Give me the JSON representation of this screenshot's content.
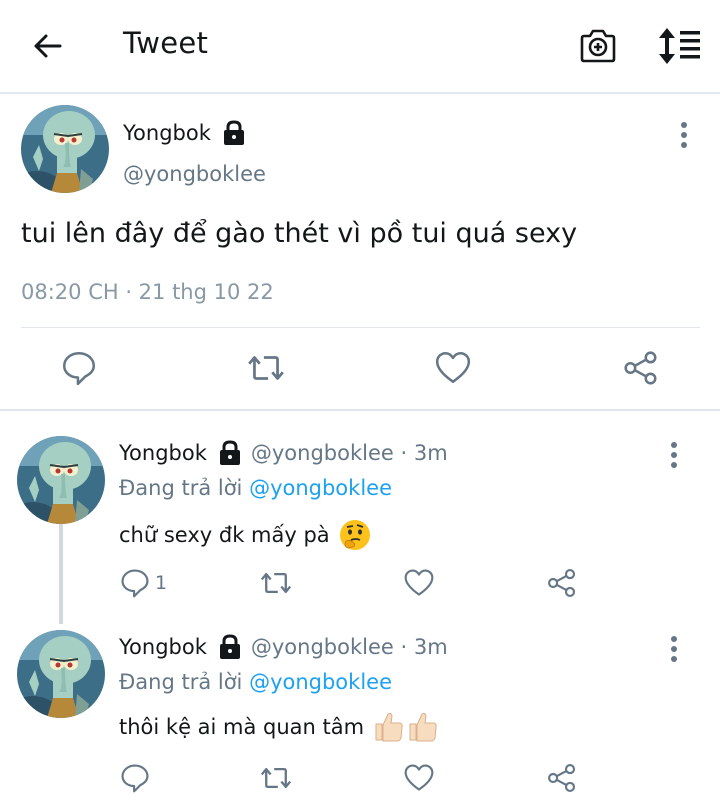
{
  "header": {
    "title": "Tweet",
    "back_icon": "arrow-left-icon",
    "camera_icon": "camera-plus-icon",
    "sort_icon": "sort-icon"
  },
  "main_tweet": {
    "name": "Yongbok",
    "handle": "@yongboklee",
    "text": "tui lên đây để gào thét vì pồ tui quá sexy",
    "time": "08:20 CH · 21 thg 10 22"
  },
  "replies": [
    {
      "name": "Yongbok",
      "handle_time": "@yongboklee · 3m",
      "replying_prefix": "Đang trả lời ",
      "replying_to": "@yongboklee",
      "text": "chữ sexy đk mấy pà",
      "emoji": "thinking-face-emoji",
      "reply_count": "1"
    },
    {
      "name": "Yongbok",
      "handle_time": "@yongboklee · 3m",
      "replying_prefix": "Đang trả lời ",
      "replying_to": "@yongboklee",
      "text": "thôi kệ ai mà quan tâm",
      "emoji": "thumbs-up-emoji",
      "reply_count": ""
    }
  ],
  "colors": {
    "accent": "#1da1f2",
    "text": "#14171a",
    "secondary": "#657786",
    "divider": "#e1e8ed",
    "icon": "#657786"
  }
}
